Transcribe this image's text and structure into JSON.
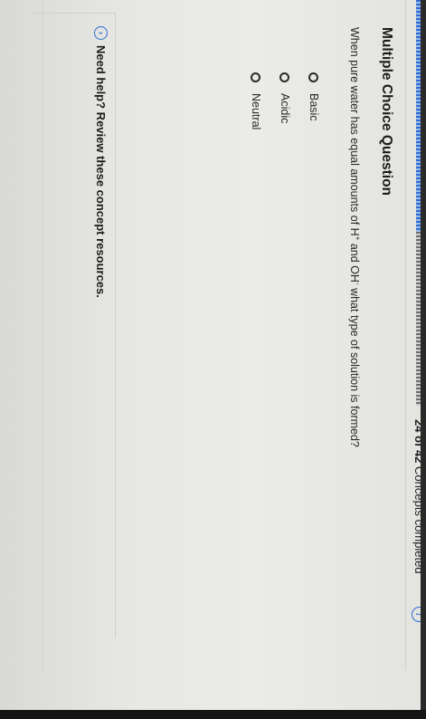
{
  "progress": {
    "count_label": "24 of 42",
    "suffix_label": " Concepts completed",
    "completed": 24,
    "total": 42
  },
  "icons": {
    "info": "i",
    "chevron": "›"
  },
  "question": {
    "type_label": "Multiple Choice Question",
    "text_before_h": "When pure water has equal amounts of H",
    "h_sup": "+",
    "text_between": " and OH",
    "oh_sup": "-",
    "text_after": " what type of solution is formed?"
  },
  "options": [
    {
      "label": "Basic"
    },
    {
      "label": "Acidic"
    },
    {
      "label": "Neutral"
    }
  ],
  "help": {
    "label": "Need help? Review these concept resources."
  },
  "colors": {
    "accent": "#2f6ed1",
    "text": "#2a2a2a"
  }
}
